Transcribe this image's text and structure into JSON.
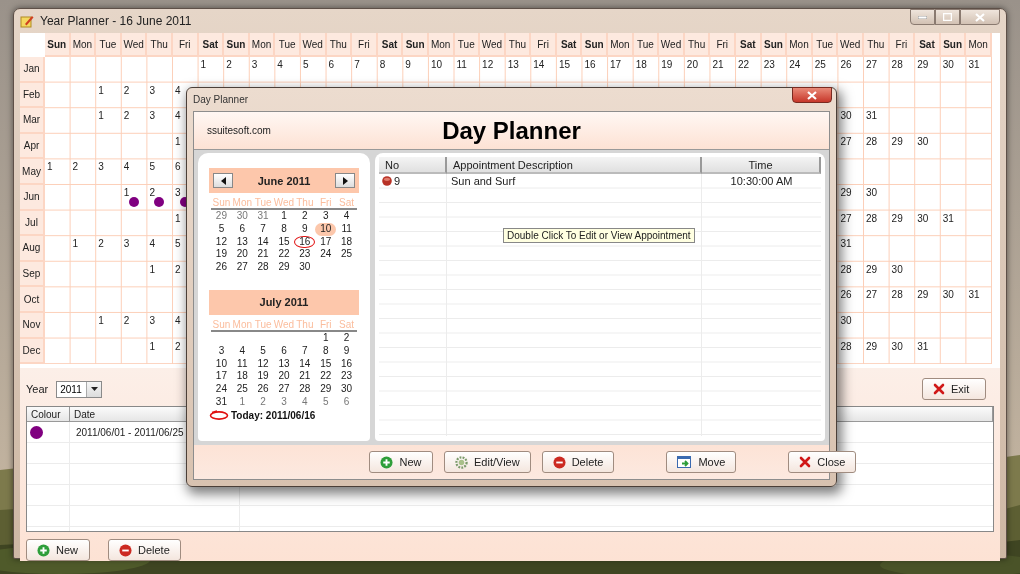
{
  "window": {
    "title": "Year Planner - 16 June 2011"
  },
  "year_grid": {
    "weekdays": [
      {
        "label": "Sun",
        "weekend": true
      },
      {
        "label": "Mon",
        "weekend": false
      },
      {
        "label": "Tue",
        "weekend": false
      },
      {
        "label": "Wed",
        "weekend": false
      },
      {
        "label": "Thu",
        "weekend": false
      },
      {
        "label": "Fri",
        "weekend": false
      },
      {
        "label": "Sat",
        "weekend": true
      },
      {
        "label": "Sun",
        "weekend": true
      },
      {
        "label": "Mon",
        "weekend": false
      },
      {
        "label": "Tue",
        "weekend": false
      },
      {
        "label": "Wed",
        "weekend": false
      },
      {
        "label": "Thu",
        "weekend": false
      },
      {
        "label": "Fri",
        "weekend": false
      },
      {
        "label": "Sat",
        "weekend": true
      },
      {
        "label": "Sun",
        "weekend": true
      },
      {
        "label": "Mon",
        "weekend": false
      },
      {
        "label": "Tue",
        "weekend": false
      },
      {
        "label": "Wed",
        "weekend": false
      },
      {
        "label": "Thu",
        "weekend": false
      },
      {
        "label": "Fri",
        "weekend": false
      },
      {
        "label": "Sat",
        "weekend": true
      },
      {
        "label": "Sun",
        "weekend": true
      },
      {
        "label": "Mon",
        "weekend": false
      },
      {
        "label": "Tue",
        "weekend": false
      },
      {
        "label": "Wed",
        "weekend": false
      },
      {
        "label": "Thu",
        "weekend": false
      },
      {
        "label": "Fri",
        "weekend": false
      },
      {
        "label": "Sat",
        "weekend": true
      },
      {
        "label": "Sun",
        "weekend": true
      },
      {
        "label": "Mon",
        "weekend": false
      },
      {
        "label": "Tue",
        "weekend": false
      },
      {
        "label": "Wed",
        "weekend": false
      },
      {
        "label": "Thu",
        "weekend": false
      },
      {
        "label": "Fri",
        "weekend": false
      },
      {
        "label": "Sat",
        "weekend": true
      },
      {
        "label": "Sun",
        "weekend": true
      },
      {
        "label": "Mon",
        "weekend": false
      }
    ],
    "months": [
      {
        "label": "Jan",
        "days": [
          "1",
          "2",
          "3",
          "4",
          "5",
          "6",
          "7",
          "8",
          "9",
          "10",
          "11",
          "12",
          "13",
          "14",
          "15",
          "16",
          "17",
          "18",
          "19",
          "20",
          "21",
          "22",
          "23",
          "24",
          "25",
          "26",
          "27",
          "28",
          "29",
          "30",
          "31"
        ]
      },
      {
        "label": "Feb",
        "start_days": [
          "1",
          "2",
          "3",
          "4"
        ]
      },
      {
        "label": "Mar",
        "start_days": [
          "1",
          "2",
          "3",
          "4"
        ],
        "end_days": [
          "30",
          "31"
        ]
      },
      {
        "label": "Apr",
        "start_days": [
          "1"
        ],
        "end_days": [
          "27",
          "28",
          "29",
          "30"
        ]
      },
      {
        "label": "May",
        "start_days": [
          "1",
          "2",
          "3",
          "4",
          "5",
          "6"
        ]
      },
      {
        "label": "Jun",
        "start_days": [
          {
            "day": "1",
            "color": "#800080"
          },
          {
            "day": "2",
            "color": "#800080"
          },
          {
            "day": "3",
            "color": "#800080"
          }
        ],
        "end_days": [
          "29",
          "30"
        ]
      },
      {
        "label": "Jul",
        "start_days": [
          "1"
        ],
        "end_days": [
          "27",
          "28",
          "29",
          "30",
          "31"
        ]
      },
      {
        "label": "Aug",
        "start_days": [
          "1",
          "2",
          "3",
          "4",
          "5"
        ],
        "end_days": [
          "31"
        ]
      },
      {
        "label": "Sep",
        "start_days": [
          "1",
          "2"
        ],
        "end_days": [
          "28",
          "29",
          "30"
        ]
      },
      {
        "label": "Oct",
        "end_days": [
          "26",
          "27",
          "28",
          "29",
          "30",
          "31"
        ]
      },
      {
        "label": "Nov",
        "start_days": [
          "1",
          "2",
          "3",
          "4"
        ],
        "end_days": [
          "30"
        ]
      },
      {
        "label": "Dec",
        "start_days": [
          "1",
          "2"
        ],
        "end_days": [
          "28",
          "29",
          "30",
          "31"
        ]
      }
    ]
  },
  "year_field": {
    "label": "Year",
    "value": "2011"
  },
  "exit_button": {
    "label": "Exit",
    "kind": "exit"
  },
  "events_table": {
    "columns": [
      "Colour",
      "Date"
    ],
    "rows": [
      {
        "color": "#800080",
        "date": "2011/06/01 - 2011/06/25"
      }
    ]
  },
  "bottom_buttons": [
    {
      "label": "New",
      "kind": "new"
    },
    {
      "label": "Delete",
      "kind": "delete"
    }
  ],
  "dialog": {
    "title": "Day Planner",
    "brand": "ssuitesoft.com",
    "heading": "Day Planner",
    "calendars": [
      {
        "title": "June 2011",
        "nav": true,
        "weekdays": [
          "Sun",
          "Mon",
          "Tue",
          "Wed",
          "Thu",
          "Fri",
          "Sat"
        ],
        "weeks": [
          [
            {
              "d": "29",
              "muted": true
            },
            {
              "d": "30",
              "muted": true
            },
            {
              "d": "31",
              "muted": true
            },
            {
              "d": "1"
            },
            {
              "d": "2"
            },
            {
              "d": "3"
            },
            {
              "d": "4"
            }
          ],
          [
            {
              "d": "5"
            },
            {
              "d": "6"
            },
            {
              "d": "7"
            },
            {
              "d": "8"
            },
            {
              "d": "9"
            },
            {
              "d": "10",
              "selected": true
            },
            {
              "d": "11"
            }
          ],
          [
            {
              "d": "12"
            },
            {
              "d": "13"
            },
            {
              "d": "14"
            },
            {
              "d": "15"
            },
            {
              "d": "16",
              "today": true
            },
            {
              "d": "17"
            },
            {
              "d": "18"
            }
          ],
          [
            {
              "d": "19"
            },
            {
              "d": "20"
            },
            {
              "d": "21"
            },
            {
              "d": "22"
            },
            {
              "d": "23"
            },
            {
              "d": "24"
            },
            {
              "d": "25"
            }
          ],
          [
            {
              "d": "26"
            },
            {
              "d": "27"
            },
            {
              "d": "28"
            },
            {
              "d": "29"
            },
            {
              "d": "30"
            }
          ]
        ]
      },
      {
        "title": "July 2011",
        "nav": false,
        "weekdays": [
          "Sun",
          "Mon",
          "Tue",
          "Wed",
          "Thu",
          "Fri",
          "Sat"
        ],
        "weeks": [
          [
            {
              "d": "1"
            },
            {
              "d": "2"
            }
          ],
          [
            {
              "d": "3"
            },
            {
              "d": "4"
            },
            {
              "d": "5"
            },
            {
              "d": "6"
            },
            {
              "d": "7"
            },
            {
              "d": "8"
            },
            {
              "d": "9"
            }
          ],
          [
            {
              "d": "10"
            },
            {
              "d": "11"
            },
            {
              "d": "12"
            },
            {
              "d": "13"
            },
            {
              "d": "14"
            },
            {
              "d": "15"
            },
            {
              "d": "16"
            }
          ],
          [
            {
              "d": "17"
            },
            {
              "d": "18"
            },
            {
              "d": "19"
            },
            {
              "d": "20"
            },
            {
              "d": "21"
            },
            {
              "d": "22"
            },
            {
              "d": "23"
            }
          ],
          [
            {
              "d": "24"
            },
            {
              "d": "25"
            },
            {
              "d": "26"
            },
            {
              "d": "27"
            },
            {
              "d": "28"
            },
            {
              "d": "29"
            },
            {
              "d": "30"
            }
          ],
          [
            {
              "d": "31"
            },
            {
              "d": "1",
              "muted": true
            },
            {
              "d": "2",
              "muted": true
            },
            {
              "d": "3",
              "muted": true
            },
            {
              "d": "4",
              "muted": true
            },
            {
              "d": "5",
              "muted": true
            },
            {
              "d": "6",
              "muted": true
            }
          ]
        ]
      }
    ],
    "today": "Today: 2011/06/16",
    "appointments": {
      "columns": [
        "No",
        "Appointment Description",
        "Time"
      ],
      "rows": [
        {
          "no": "9",
          "description": "Sun and Surf",
          "time": "10:30:00 AM"
        }
      ]
    },
    "tooltip": "Double Click To Edit or View Appointment",
    "buttons": [
      {
        "label": "New",
        "kind": "new"
      },
      {
        "label": "Edit/View",
        "kind": "edit"
      },
      {
        "label": "Delete",
        "kind": "delete"
      },
      {
        "label": "Move",
        "kind": "move"
      },
      {
        "label": "Close",
        "kind": "close"
      }
    ]
  }
}
